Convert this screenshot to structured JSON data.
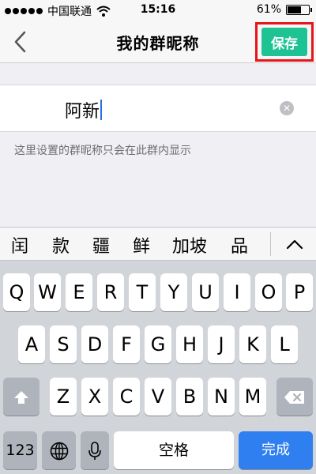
{
  "status_bar": {
    "carrier": "中国联通",
    "time": "15:16",
    "battery": "61%"
  },
  "nav": {
    "title": "我的群昵称",
    "save_label": "保存",
    "back_icon": "chevron-left-icon"
  },
  "input": {
    "value": "阿新"
  },
  "hint": "这里设置的群昵称只会在此群内显示",
  "candidates": [
    "闰",
    "款",
    "疆",
    "鲜",
    "加坡",
    "品"
  ],
  "keyboard": {
    "row1": [
      "Q",
      "W",
      "E",
      "R",
      "T",
      "Y",
      "U",
      "I",
      "O",
      "P"
    ],
    "row2": [
      "A",
      "S",
      "D",
      "F",
      "G",
      "H",
      "J",
      "K",
      "L"
    ],
    "row3": [
      "Z",
      "X",
      "C",
      "V",
      "B",
      "N",
      "M"
    ],
    "numbers_label": "123",
    "space_label": "空格",
    "done_label": "完成"
  },
  "colors": {
    "save": "#1ec393",
    "done": "#2f7ff0",
    "caret": "#2c6ee6",
    "highlight": "#e8141b"
  }
}
